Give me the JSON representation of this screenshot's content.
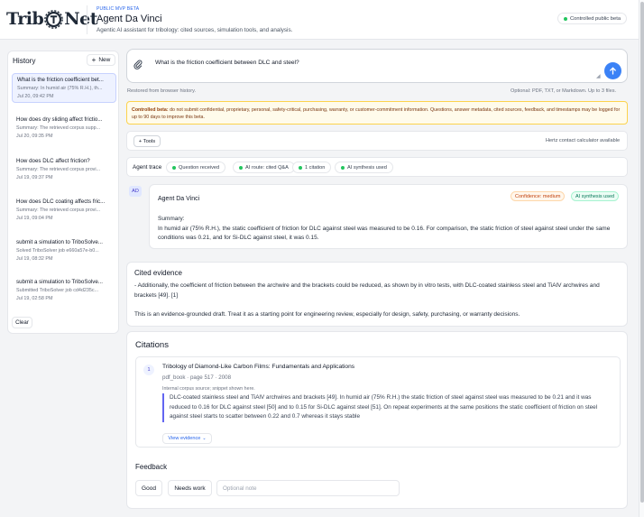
{
  "header": {
    "logo_left": "Trib",
    "logo_right": "Net",
    "beta_tag": "PUBLIC MVP BETA",
    "title": "Agent Da Vinci",
    "subtitle": "Agentic AI assistant for tribology: cited sources, simulation tools, and analysis.",
    "status": "Controlled public beta"
  },
  "sidebar": {
    "title": "History",
    "new_label": "New",
    "clear_label": "Clear",
    "items": [
      {
        "title": "What is the friction coefficient bet...",
        "summary": "Summary: In humid air (75% R.H.), th...",
        "time": "Jul 20, 09:42 PM"
      },
      {
        "title": "How does dry sliding affect frictio...",
        "summary": "Summary: The retrieved corpus supp...",
        "time": "Jul 20, 09:35 PM"
      },
      {
        "title": "How does DLC affect friction?",
        "summary": "Summary: The retrieved corpus provi...",
        "time": "Jul 19, 09:37 PM"
      },
      {
        "title": "How does DLC coating affects fric...",
        "summary": "Summary: The retrieved corpus provi...",
        "time": "Jul 19, 09:04 PM"
      },
      {
        "title": "submit a simulation to TriboSolve...",
        "summary": "Solved TriboSolver job e660a57e-b0...",
        "time": "Jul 19, 08:32 PM"
      },
      {
        "title": "submit a simulation to TriboSolve...",
        "summary": "Submitted TriboSolver job cd4d235c...",
        "time": "Jul 19, 02:58 PM"
      }
    ]
  },
  "composer": {
    "prompt": "What is the friction coefficient between DLC and steel?",
    "restored_note": "Restored from browser history.",
    "optional_note": "Optional: PDF, TXT, or Markdown. Up to 3 files."
  },
  "warning": {
    "label": "Controlled beta:",
    "text": "do not submit confidential, proprietary, personal, safety-critical, purchasing, warranty, or customer-commitment information. Questions, answer metadata, cited sources, feedback, and timestamps may be logged for up to 90 days to improve this beta."
  },
  "tools": {
    "button": "+ Tools",
    "hertz": "Hertz contact calculator available"
  },
  "trace": {
    "label": "Agent trace",
    "chips": [
      "Question received",
      "AI route: cited Q&A",
      "1 citation",
      "AI synthesis used"
    ]
  },
  "message": {
    "avatar": "AD",
    "name": "Agent Da Vinci",
    "confidence": "Confidence: medium",
    "synthesis": "AI synthesis used",
    "summary_label": "Summary:",
    "body": "In humid air (75% R.H.), the static coefficient of friction for DLC against steel was measured to be 0.16. For comparison, the static friction of steel against steel under the same conditions was 0.21, and for Si-DLC against steel, it was 0.15."
  },
  "evidence": {
    "title": "Cited evidence",
    "text": "- Additionally, the coefficient of friction between the archwire and the brackets could be reduced, as shown by in vitro tests, with DLC-coated stainless steel and TiAlV archwires and brackets [49]. [1]",
    "note": "This is an evidence-grounded draft. Treat it as a starting point for engineering review, especially for design, safety, purchasing, or warranty decisions."
  },
  "citations": {
    "title": "Citations",
    "items": [
      {
        "num": "1",
        "title": "Tribology of Diamond-Like Carbon Films: Fundamentals and Applications",
        "meta": "pdf_book · page 517 · 2008",
        "internal": "Internal corpus source; snippet shown here.",
        "quote": "DLC-coated stainless steel and TiAlV archwires and brackets [49]. In humid air (75% R.H.) the static friction of steel against steel was measured to be 0.21 and it was reduced to 0.16 for DLC against steel [50] and to 0.15 for Si-DLC against steel [51]. On repeat experiments at the same positions the static coefficient of friction on steel against steel starts to scatter between 0.22 and 0.7 whereas it stays stable",
        "view_label": "View evidence"
      }
    ]
  },
  "feedback": {
    "title": "Feedback",
    "good": "Good",
    "needs_work": "Needs work",
    "note_placeholder": "Optional note"
  },
  "colors": {
    "accent": "#3b82f6",
    "success": "#22c55e",
    "warning_bg": "#fffbeb",
    "citation_bar": "#6366f1"
  }
}
